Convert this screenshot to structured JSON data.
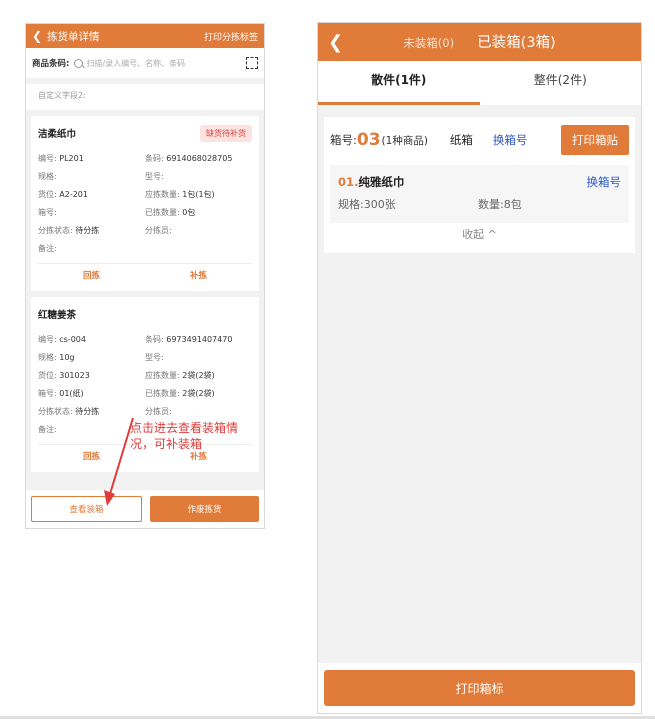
{
  "left": {
    "header": {
      "title": "拣货单详情",
      "right_action": "打印分拣标签"
    },
    "search": {
      "label": "商品条码:",
      "placeholder": "扫描/录入编号、名称、条码"
    },
    "custom_field": "自定义字段2:",
    "cards": [
      {
        "name": "洁柔纸巾",
        "tag": "缺货待补货",
        "fields": {
          "code_lbl": "编号:",
          "code": "PL201",
          "barcode_lbl": "条码:",
          "barcode": "6914068028705",
          "spec_lbl": "规格:",
          "spec": "",
          "model_lbl": "型号:",
          "model": "",
          "loc_lbl": "货位:",
          "loc": "A2-201",
          "need_lbl": "应拣数量:",
          "need": "1包(1包)",
          "box_lbl": "箱号:",
          "box": "",
          "done_lbl": "已拣数量:",
          "done": "0包",
          "status_lbl": "分拣状态:",
          "status": "待分拣",
          "picker_lbl": "分拣员:",
          "picker": "",
          "remark_lbl": "备注:",
          "remark": ""
        },
        "actions": [
          "回拣",
          "补拣"
        ]
      },
      {
        "name": "红糖姜茶",
        "tag": "",
        "fields": {
          "code_lbl": "编号:",
          "code": "cs-004",
          "barcode_lbl": "条码:",
          "barcode": "6973491407470",
          "spec_lbl": "规格:",
          "spec": "10g",
          "model_lbl": "型号:",
          "model": "",
          "loc_lbl": "货位:",
          "loc": "301023",
          "need_lbl": "应拣数量:",
          "need": "2袋(2袋)",
          "box_lbl": "箱号:",
          "box": "01(纸)",
          "done_lbl": "已拣数量:",
          "done": "2袋(2袋)",
          "status_lbl": "分拣状态:",
          "status": "待分拣",
          "picker_lbl": "分拣员:",
          "picker": "",
          "remark_lbl": "备注:",
          "remark": ""
        },
        "actions": [
          "回拣",
          "补拣"
        ]
      }
    ],
    "bottom": {
      "view_box": "查看装箱",
      "cancel": "作废拣货"
    },
    "annotation": "点击进去查看装箱情况，可补装箱"
  },
  "right": {
    "header": {
      "tab_unpacked": "未装箱(0)",
      "tab_packed": "已装箱(3箱)"
    },
    "subtabs": [
      "散件(1件)",
      "整件(2件)"
    ],
    "box": {
      "no_label": "箱号:",
      "no_value": "03",
      "count": "(1种商品)",
      "type": "纸箱",
      "change_no": "换箱号",
      "print_label": "打印箱贴"
    },
    "item": {
      "index": "01.",
      "name": "纯雅纸巾",
      "change_box": "换箱号",
      "spec": "规格:300张",
      "qty": "数量:8包"
    },
    "collapse": "收起 ^",
    "bottom": {
      "print": "打印箱标"
    }
  },
  "colors": {
    "accent": "#e07b39",
    "link": "#2b57c8",
    "warn": "#d9403a"
  }
}
